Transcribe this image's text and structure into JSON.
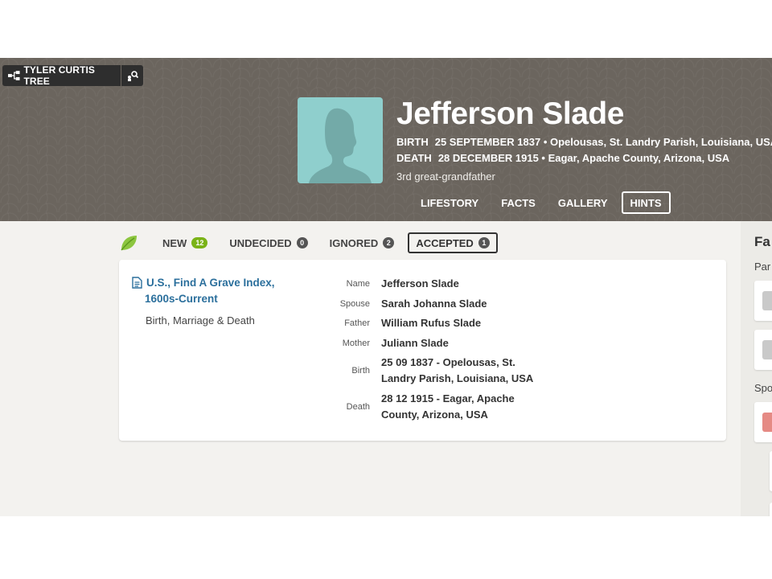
{
  "tree": {
    "name": "TYLER CURTIS TREE"
  },
  "person": {
    "name": "Jefferson Slade",
    "birth_label": "BIRTH",
    "birth_value": "25 SEPTEMBER 1837 • Opelousas, St. Landry Parish, Louisiana, USA",
    "death_label": "DEATH",
    "death_value": "28 DECEMBER 1915 • Eagar, Apache County, Arizona, USA",
    "relationship": "3rd great-grandfather"
  },
  "person_tabs": [
    {
      "label": "LIFESTORY",
      "active": false
    },
    {
      "label": "FACTS",
      "active": false
    },
    {
      "label": "GALLERY",
      "active": false
    },
    {
      "label": "HINTS",
      "active": true
    }
  ],
  "hint_filters": [
    {
      "label": "NEW",
      "count": "12",
      "active": false
    },
    {
      "label": "UNDECIDED",
      "count": "0",
      "active": false
    },
    {
      "label": "IGNORED",
      "count": "2",
      "active": false
    },
    {
      "label": "ACCEPTED",
      "count": "1",
      "active": true
    }
  ],
  "hint": {
    "title_line1": "U.S., Find A Grave Index,",
    "title_line2": "1600s-Current",
    "record_type": "Birth, Marriage & Death",
    "facts": [
      {
        "label": "Name",
        "value": "Jefferson Slade"
      },
      {
        "label": "Spouse",
        "value": "Sarah Johanna Slade"
      },
      {
        "label": "Father",
        "value": "William Rufus Slade"
      },
      {
        "label": "Mother",
        "value": "Juliann Slade"
      },
      {
        "label": "Birth",
        "value_line1": "25 09 1837 - Opelousas, St.",
        "value_line2": "Landry Parish, Louisiana, USA"
      },
      {
        "label": "Death",
        "value_line1": "28 12 1915 - Eagar, Apache",
        "value_line2": "County, Arizona, USA"
      }
    ]
  },
  "family_panel": {
    "heading": "Fa",
    "parents_label": "Par",
    "spouse_label": "Spo"
  },
  "colors": {
    "header_bg": "#6b655e",
    "avatar_bg": "#8fcfcd",
    "link": "#2b6f9c",
    "new_badge": "#7ab317",
    "female_avatar": "#e58a84"
  },
  "icons": [
    "tree-icon",
    "tree-search-icon",
    "person-silhouette-icon",
    "leaf-icon",
    "record-document-icon"
  ]
}
